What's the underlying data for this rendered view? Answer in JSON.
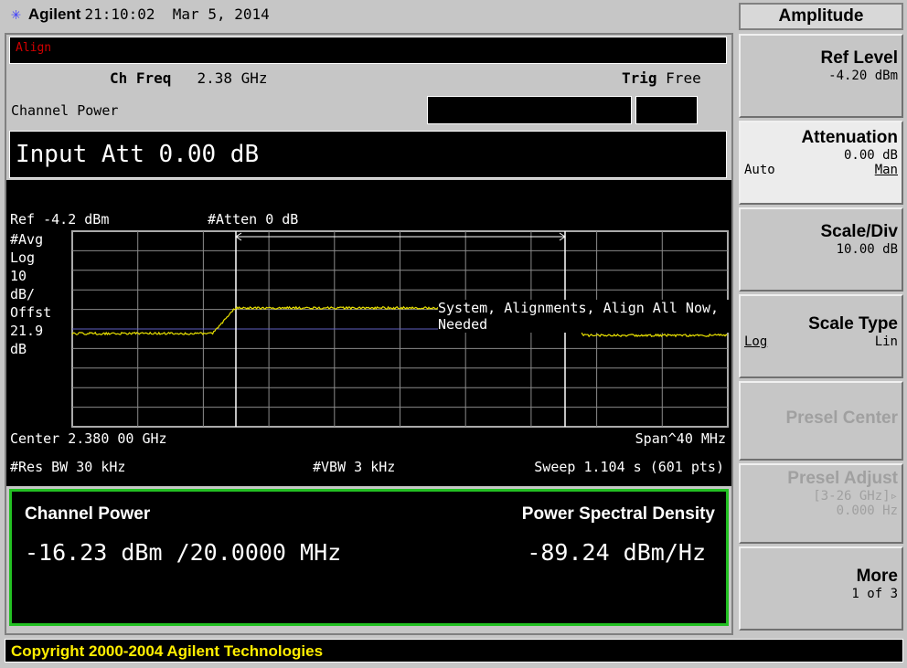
{
  "header": {
    "brand": "Agilent",
    "time": "21:10:02",
    "date": "Mar 5, 2014",
    "logo_icon": "agilent-spark-icon"
  },
  "status": {
    "align": "Align",
    "ch_freq_label": "Ch Freq",
    "ch_freq_value": "2.38 GHz",
    "trig_label": "Trig",
    "trig_value": "Free",
    "mode": "Channel Power",
    "active_entry": "Input Att 0.00 dB"
  },
  "graph": {
    "ref": "Ref -4.2 dBm",
    "atten": "#Atten 0 dB",
    "left_labels": [
      "#Avg",
      "Log",
      "10",
      "dB/",
      "Offst",
      "21.9",
      "dB"
    ],
    "message": "System, Alignments, Align All Now, Needed",
    "center": "Center 2.380 00 GHz",
    "span": "Span^40 MHz",
    "res_bw": "#Res BW 30 kHz",
    "vbw": "#VBW 3 kHz",
    "sweep": "Sweep 1.104 s (601 pts)",
    "trace_color": "#e8e000"
  },
  "results": {
    "cp_label": "Channel Power",
    "cp_value": "-16.23 dBm /20.0000 MHz",
    "psd_label": "Power Spectral Density",
    "psd_value": "-89.24 dBm/Hz",
    "border_color": "#22c022"
  },
  "footer": {
    "copyright": "Copyright 2000-2004 Agilent Technologies"
  },
  "softkeys": {
    "menu_title": "Amplitude",
    "ref_level": {
      "label": "Ref Level",
      "value": "-4.20 dBm"
    },
    "attenuation": {
      "label": "Attenuation",
      "value": "0.00 dB",
      "opt1": "Auto",
      "opt2": "Man"
    },
    "scale_div": {
      "label": "Scale/Div",
      "value": "10.00 dB"
    },
    "scale_type": {
      "label": "Scale Type",
      "opt1": "Log",
      "opt2": "Lin"
    },
    "presel_center": {
      "label": "Presel Center"
    },
    "presel_adjust": {
      "label": "Presel Adjust",
      "range": "[3-26 GHz]▹",
      "value": "0.000  Hz"
    },
    "more": {
      "label": "More",
      "value": "1 of 3"
    }
  }
}
